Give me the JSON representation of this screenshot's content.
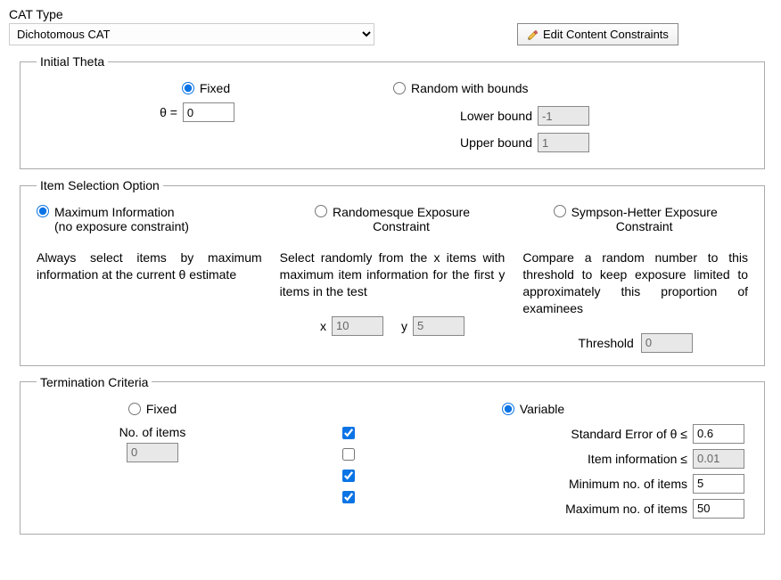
{
  "catType": {
    "label": "CAT Type",
    "selected": "Dichotomous CAT"
  },
  "editBtn": {
    "label": "Edit Content Constraints"
  },
  "initialTheta": {
    "legend": "Initial Theta",
    "fixed": {
      "label": "Fixed",
      "thetaSymbol": "θ =",
      "value": "0"
    },
    "random": {
      "label": "Random with bounds",
      "lowerLabel": "Lower bound",
      "lowerValue": "-1",
      "upperLabel": "Upper bound",
      "upperValue": "1"
    }
  },
  "iso": {
    "legend": "Item Selection Option",
    "maxInfo": {
      "label1": "Maximum Information",
      "label2": "(no exposure constraint)",
      "desc": "Always select items by maximum information at the current θ estimate"
    },
    "randomesque": {
      "label1": "Randomesque Exposure",
      "label2": "Constraint",
      "desc": "Select randomly from the x items with maximum item information for the first y items in the test",
      "xLabel": "x",
      "xValue": "10",
      "yLabel": "y",
      "yValue": "5"
    },
    "sympson": {
      "label1": "Sympson-Hetter Exposure",
      "label2": "Constraint",
      "desc": "Compare a random number to this threshold to keep exposure limited to approximately this proportion of examinees",
      "thrLabel": "Threshold",
      "thrValue": "0"
    }
  },
  "tc": {
    "legend": "Termination Criteria",
    "fixed": {
      "label": "Fixed",
      "noiLabel": "No. of items",
      "noiValue": "0"
    },
    "variable": {
      "label": "Variable",
      "seLabel": "Standard Error of θ ≤",
      "seValue": "0.6",
      "iiLabel": "Item information ≤",
      "iiValue": "0.01",
      "minLabel": "Minimum no. of items",
      "minValue": "5",
      "maxLabel": "Maximum no. of items",
      "maxValue": "50"
    }
  }
}
